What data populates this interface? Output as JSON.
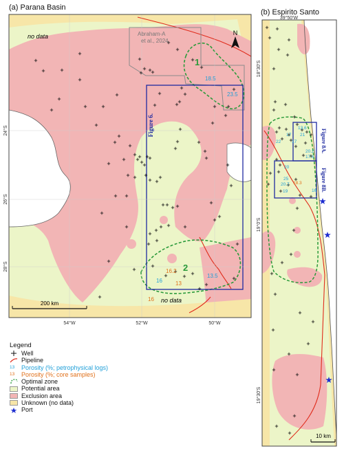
{
  "panel_a": {
    "title": "(a) Parana Basin",
    "no_data_labels": [
      "no data",
      "no data"
    ],
    "study_box_label": "Abraham-A\net al., 2024",
    "zone_labels": [
      "1",
      "2"
    ],
    "figure_label": "Figure 6.",
    "lon_ticks": [
      "54°W",
      "52°W",
      "50°W"
    ],
    "lat_ticks": [
      "24°S",
      "26°S",
      "28°S"
    ],
    "scale_bar": "200 km",
    "north": "N",
    "porosity_log_values": [
      "18.5",
      "23.5",
      "16",
      "13.5"
    ],
    "porosity_core_values": [
      "16.2",
      "13",
      "16"
    ]
  },
  "panel_b": {
    "title": "(b) Espirito Santo",
    "lon_tick": "39°50'W",
    "lat_ticks": [
      "18°30'S",
      "19°0'S",
      "19°30'S"
    ],
    "figure_labels": [
      "Figure 8A.",
      "Figure 8B."
    ],
    "porosity_log_values": [
      "13.6",
      "21",
      "17",
      "17",
      "20.2",
      "17.6",
      "22",
      "20",
      "25",
      "20.7",
      "19",
      "16"
    ],
    "porosity_core_values": [
      "18.3"
    ],
    "scale_bar": "10 km"
  },
  "legend": {
    "title": "Legend",
    "items": [
      {
        "label": "Well",
        "symbol": "cross-icon"
      },
      {
        "label": "Pipeline",
        "symbol": "red-line-icon"
      },
      {
        "label": "Porosity (%; petrophysical logs)",
        "symbol": "blue-number-icon",
        "sample": "13",
        "color": "#1f9fd8"
      },
      {
        "label": "Porosity (%; core samples)",
        "symbol": "orange-number-icon",
        "sample": "13",
        "color": "#e0701a"
      },
      {
        "label": "Optimal zone",
        "symbol": "green-dashed-icon"
      },
      {
        "label": "Potential area",
        "symbol": "light-green-swatch",
        "color": "#ecf5c8"
      },
      {
        "label": "Exclusion area",
        "symbol": "pink-swatch",
        "color": "#f2b5b5"
      },
      {
        "label": "Unknown (no data)",
        "symbol": "tan-swatch",
        "color": "#f7e6a8"
      },
      {
        "label": "Port",
        "symbol": "blue-star-icon",
        "color": "#1f2fd0"
      }
    ]
  },
  "colors": {
    "potential": "#ecf5c8",
    "exclusion": "#f2b5b5",
    "unknown": "#f7e6a8",
    "pipeline": "#e02a1a",
    "optimal": "#2a9a3a",
    "frame_box": "#1e2aa0",
    "log_text": "#1f9fd8",
    "core_text": "#e0701a",
    "port": "#1f2fd0"
  }
}
